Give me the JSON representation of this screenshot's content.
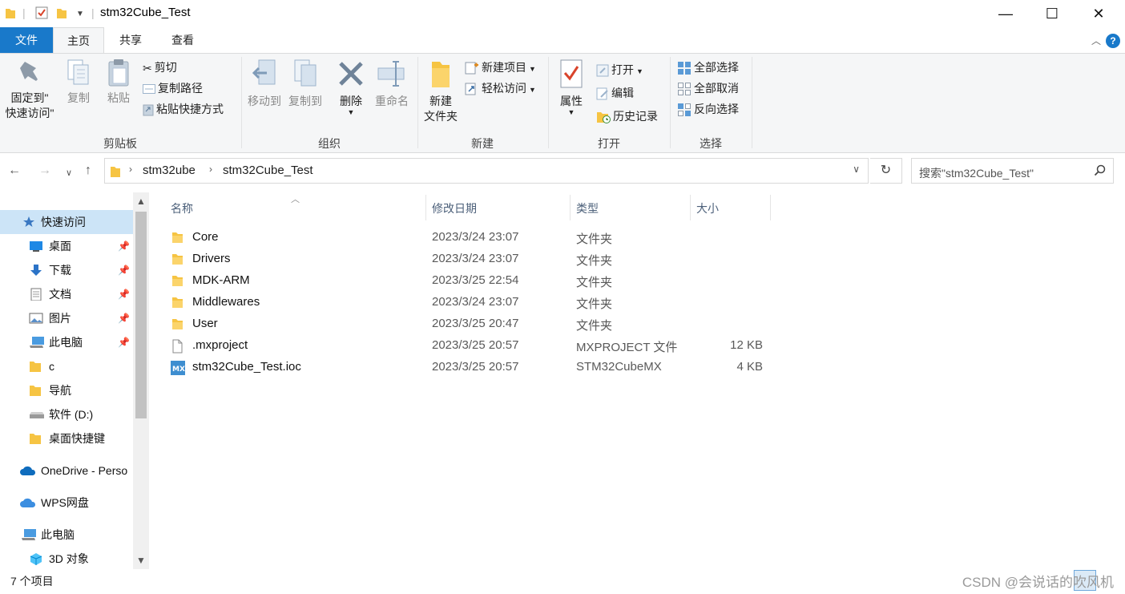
{
  "window": {
    "title": "stm32Cube_Test",
    "minimize": "—",
    "maximize": "☐",
    "close": "✕"
  },
  "tabs": {
    "file": "文件",
    "home": "主页",
    "share": "共享",
    "view": "查看"
  },
  "ribbon": {
    "clipboard": {
      "label": "剪贴板",
      "pin_line1": "固定到\"",
      "pin_line2": "快速访问\"",
      "copy": "复制",
      "paste": "粘贴",
      "cut": "剪切",
      "copy_path": "复制路径",
      "paste_shortcut": "粘贴快捷方式"
    },
    "organize": {
      "label": "组织",
      "move_to": "移动到",
      "copy_to": "复制到",
      "delete": "删除",
      "rename": "重命名"
    },
    "new": {
      "label": "新建",
      "new_folder_line1": "新建",
      "new_folder_line2": "文件夹",
      "new_item": "新建项目",
      "easy_access": "轻松访问"
    },
    "open": {
      "label": "打开",
      "properties": "属性",
      "open": "打开",
      "edit": "编辑",
      "history": "历史记录"
    },
    "select": {
      "label": "选择",
      "select_all": "全部选择",
      "select_none": "全部取消",
      "invert": "反向选择"
    }
  },
  "address": {
    "crumbs": [
      "stm32ube",
      "stm32Cube_Test"
    ],
    "search_placeholder": "搜索\"stm32Cube_Test\""
  },
  "navpane": {
    "items": [
      {
        "label": "快速访问",
        "icon": "star-icon",
        "pinned": false
      },
      {
        "label": "桌面",
        "icon": "desktop-icon",
        "pinned": true
      },
      {
        "label": "下载",
        "icon": "download-icon",
        "pinned": true
      },
      {
        "label": "文档",
        "icon": "document-icon",
        "pinned": true
      },
      {
        "label": "图片",
        "icon": "picture-icon",
        "pinned": true
      },
      {
        "label": "此电脑",
        "icon": "computer-icon",
        "pinned": true
      },
      {
        "label": "c",
        "icon": "folder-icon",
        "pinned": false
      },
      {
        "label": "导航",
        "icon": "folder-icon",
        "pinned": false
      },
      {
        "label": "软件 (D:)",
        "icon": "drive-icon",
        "pinned": false
      },
      {
        "label": "桌面快捷键",
        "icon": "folder-icon",
        "pinned": false
      },
      {
        "label": "OneDrive - Perso",
        "icon": "cloud-icon",
        "pinned": false
      },
      {
        "label": "WPS网盘",
        "icon": "cloud-icon",
        "pinned": false
      },
      {
        "label": "此电脑",
        "icon": "computer-icon",
        "pinned": false
      },
      {
        "label": "3D 对象",
        "icon": "cube-icon",
        "pinned": false
      }
    ]
  },
  "filelist": {
    "columns": [
      "名称",
      "修改日期",
      "类型",
      "大小"
    ],
    "rows": [
      {
        "name": "Core",
        "date": "2023/3/24 23:07",
        "type": "文件夹",
        "size": "",
        "icon": "folder-icon"
      },
      {
        "name": "Drivers",
        "date": "2023/3/24 23:07",
        "type": "文件夹",
        "size": "",
        "icon": "folder-icon"
      },
      {
        "name": "MDK-ARM",
        "date": "2023/3/25 22:54",
        "type": "文件夹",
        "size": "",
        "icon": "folder-icon"
      },
      {
        "name": "Middlewares",
        "date": "2023/3/24 23:07",
        "type": "文件夹",
        "size": "",
        "icon": "folder-icon"
      },
      {
        "name": "User",
        "date": "2023/3/25 20:47",
        "type": "文件夹",
        "size": "",
        "icon": "folder-icon"
      },
      {
        "name": ".mxproject",
        "date": "2023/3/25 20:57",
        "type": "MXPROJECT 文件",
        "size": "12 KB",
        "icon": "file-icon"
      },
      {
        "name": "stm32Cube_Test.ioc",
        "date": "2023/3/25 20:57",
        "type": "STM32CubeMX",
        "size": "4 KB",
        "icon": "mx-icon"
      }
    ]
  },
  "status": {
    "count": "7 个项目",
    "watermark": "CSDN @会说话的吹风机"
  },
  "colors": {
    "accent": "#1979ca",
    "selection": "#cce4f7",
    "folder": "#f6c443"
  }
}
